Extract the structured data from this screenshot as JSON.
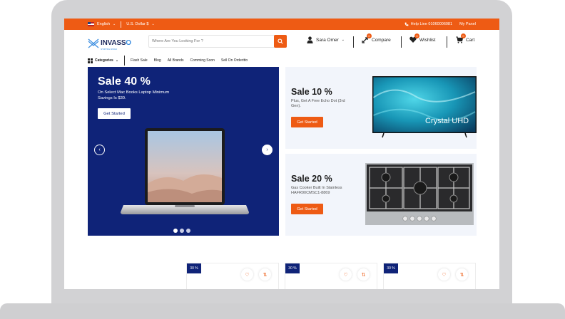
{
  "topbar": {
    "language": "English",
    "currency": "U.S. Dollar $",
    "helpline": "Help Line 01060006081",
    "my_panel": "My Panel"
  },
  "header": {
    "logo_text": "INVASS",
    "logo_o": "O",
    "logo_tagline": "SHOPPING WORLD",
    "search_placeholder": "Where Are You Looking For ?",
    "user_name": "Sara Omer",
    "compare_label": "Compare",
    "compare_count": "0",
    "wishlist_label": "Wishlist",
    "wishlist_count": "0",
    "cart_label": "Cart",
    "cart_count": "0"
  },
  "nav": {
    "categories_label": "Categories",
    "links": [
      "Flash Sale",
      "Blog",
      "All Brands",
      "Comming Soon",
      "Sell On Orderitto"
    ]
  },
  "hero": {
    "title": "Sale 40 %",
    "subtitle": "On Select Mac Books Laptop Minimum Savings Is $30.",
    "button": "Get Started",
    "slides": 3,
    "active_slide": 0
  },
  "promos": [
    {
      "title": "Sale 10 %",
      "subtitle": "Plus, Get A Free Echo Dot (3rd Gen).",
      "button": "Get Started",
      "tv_text": "Crystal UHD"
    },
    {
      "title": "Sale 20 %",
      "subtitle": "Gas Cooker Built In Stainless HAFR90CMSC1-8869",
      "button": "Get Started"
    }
  ],
  "products": [
    {
      "discount": "30 %"
    },
    {
      "discount": "30 %"
    },
    {
      "discount": "30 %"
    }
  ],
  "colors": {
    "accent": "#ee5b14",
    "navy": "#0f2378",
    "promo_bg": "#f2f5fb"
  }
}
